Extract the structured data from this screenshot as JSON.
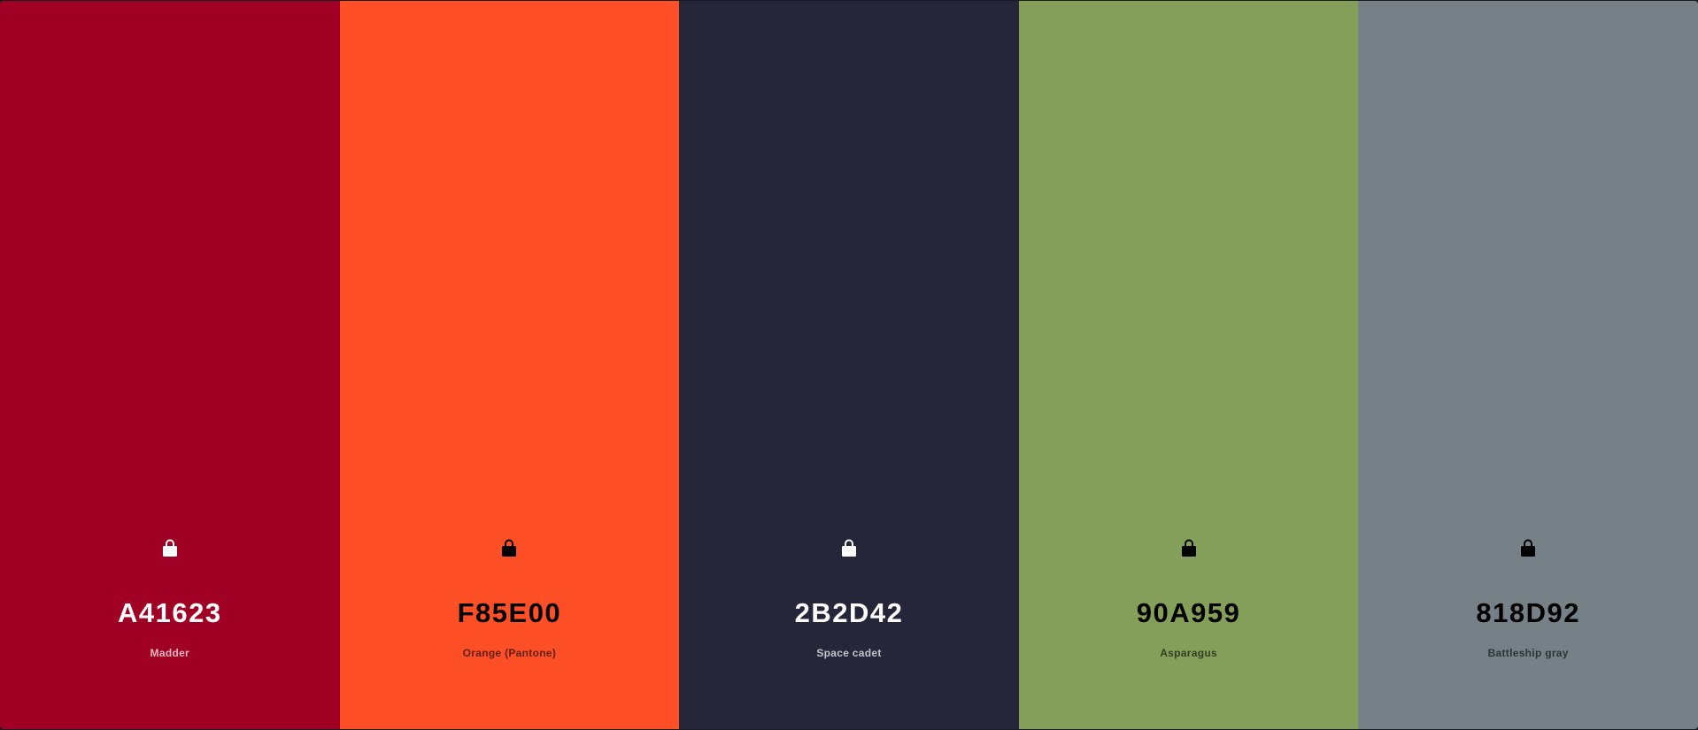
{
  "palette": {
    "colors": [
      {
        "hex": "A41623",
        "name": "Madder",
        "bg": "#A00024",
        "text_color": "#FFFFFF",
        "name_color": "rgba(255,255,255,0.72)",
        "icon_color": "#FFFFFF",
        "lock_icon": "lock-icon"
      },
      {
        "hex": "F85E00",
        "name": "Orange (Pantone)",
        "bg": "#FF4F26",
        "text_color": "#000000",
        "name_color": "rgba(0,0,0,0.62)",
        "icon_color": "#000000",
        "lock_icon": "lock-icon"
      },
      {
        "hex": "2B2D42",
        "name": "Space cadet",
        "bg": "#252639",
        "text_color": "#FFFFFF",
        "name_color": "rgba(255,255,255,0.72)",
        "icon_color": "#FFFFFF",
        "lock_icon": "lock-icon"
      },
      {
        "hex": "90A959",
        "name": "Asparagus",
        "bg": "#839F59",
        "text_color": "#000000",
        "name_color": "rgba(0,0,0,0.62)",
        "icon_color": "#000000",
        "lock_icon": "lock-icon"
      },
      {
        "hex": "818D92",
        "name": "Battleship gray",
        "bg": "#758187",
        "text_color": "#000000",
        "name_color": "rgba(0,0,0,0.62)",
        "icon_color": "#000000",
        "lock_icon": "lock-icon"
      }
    ]
  }
}
